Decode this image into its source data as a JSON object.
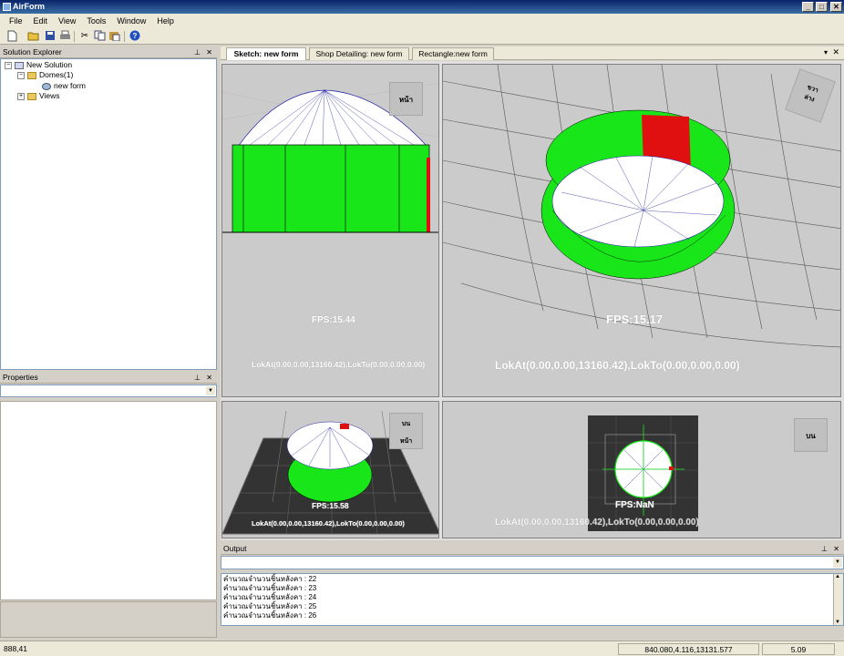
{
  "window": {
    "title": "AirForm",
    "minimize": "_",
    "maximize": "□",
    "close": "✕"
  },
  "menu": [
    "File",
    "Edit",
    "View",
    "Tools",
    "Window",
    "Help"
  ],
  "toolbar_icons": [
    "new-icon",
    "open-icon",
    "save-icon",
    "print-icon",
    "cut-icon",
    "copy-icon",
    "paste-icon",
    "help-icon"
  ],
  "solution_explorer": {
    "title": "Solution Explorer",
    "tree": [
      {
        "label": "New Solution",
        "toggle": "−"
      },
      {
        "label": "Domes(1)",
        "toggle": "−"
      },
      {
        "label": "new form",
        "toggle": ""
      },
      {
        "label": "Views",
        "toggle": "+"
      }
    ]
  },
  "properties": {
    "title": "Properties"
  },
  "tabs": [
    "Sketch: new form",
    "Shop Detailing: new form",
    "Rectangle:new form"
  ],
  "views": {
    "front": {
      "fps": "FPS:15.44",
      "look": "LokAt(0.00,0.00,13160.42),LokTo(0.00,0.00,0.00)",
      "cube_label": "หน้า"
    },
    "perspective": {
      "fps": "FPS:15.17",
      "look": "LokAt(0.00,0.00,13160.42),LokTo(0.00,0.00,0.00)",
      "cube_a": "ขวา",
      "cube_b": "ล่าง"
    },
    "iso": {
      "fps": "FPS:15.58",
      "look": "LokAt(0.00,0.00,13160.42),LokTo(0.00,0.00,0.00)",
      "cube_top": "บน",
      "cube_front": "หน้า"
    },
    "top": {
      "fps": "FPS:NaN",
      "look": "LokAt(0.00,0.00,13160.42),LokTo(0.00,0.00,0.00)",
      "cube_label": "บน"
    }
  },
  "output": {
    "title": "Output",
    "lines": [
      "คำนวณจำนวนชิ้นหลังคา : 22",
      "คำนวณจำนวนชิ้นหลังคา : 23",
      "คำนวณจำนวนชิ้นหลังคา : 24",
      "คำนวณจำนวนชิ้นหลังคา : 25",
      "คำนวณจำนวนชิ้นหลังคา : 26"
    ]
  },
  "status": {
    "coords": "888,41",
    "world": "840.080,4.116,13131.577",
    "zoom": "5.09"
  },
  "colors": {
    "dome_green": "#19e619",
    "dome_red": "#e01010",
    "title_blue": "#0a246a",
    "view_bg": "#cbcbcb"
  }
}
